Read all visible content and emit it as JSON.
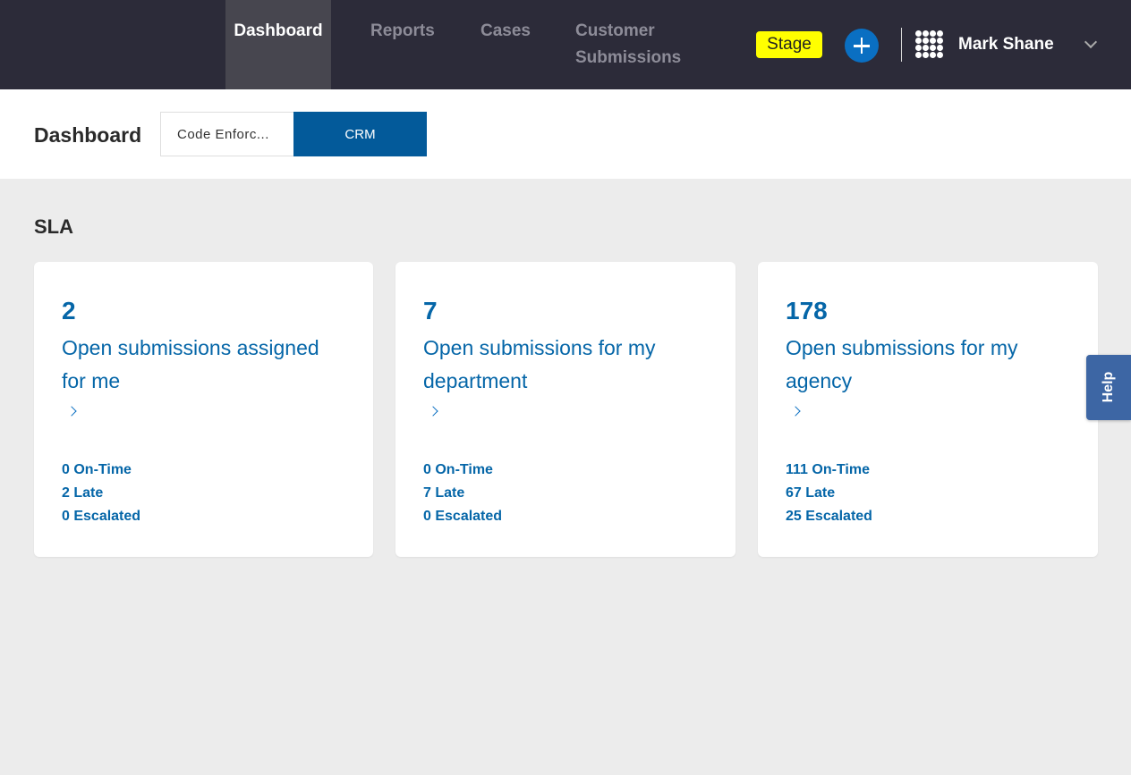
{
  "nav": {
    "items": [
      {
        "label": "Dashboard",
        "active": true
      },
      {
        "label": "Reports",
        "active": false
      },
      {
        "label": "Cases",
        "active": false
      },
      {
        "label": "Customer Submissions",
        "active": false
      }
    ],
    "environment_badge": "Stage",
    "user_name": "Mark Shane",
    "icons": {
      "add": "plus-circle-icon",
      "apps": "grid-dots-icon",
      "user_menu": "chevron-down-icon"
    }
  },
  "header": {
    "title": "Dashboard",
    "toggle": {
      "options": [
        "Code Enforc...",
        "CRM"
      ],
      "selected": "CRM"
    }
  },
  "sla": {
    "title": "SLA",
    "cards": [
      {
        "count": "2",
        "title": "Open submissions assigned for me",
        "on_time": "0 On-Time",
        "late": "2 Late",
        "escalated": "0 Escalated"
      },
      {
        "count": "7",
        "title": "Open submissions for my department",
        "on_time": "0 On-Time",
        "late": "7 Late",
        "escalated": "0 Escalated"
      },
      {
        "count": "178",
        "title": "Open submissions for my agency",
        "on_time": "111 On-Time",
        "late": "67 Late",
        "escalated": "25 Escalated"
      }
    ]
  },
  "help": {
    "label": "Help"
  },
  "colors": {
    "topbar": "#2c2b39",
    "accent": "#0566a8",
    "selected_toggle": "#035a9a",
    "stage_badge": "#ffff00",
    "background": "#ececec"
  }
}
